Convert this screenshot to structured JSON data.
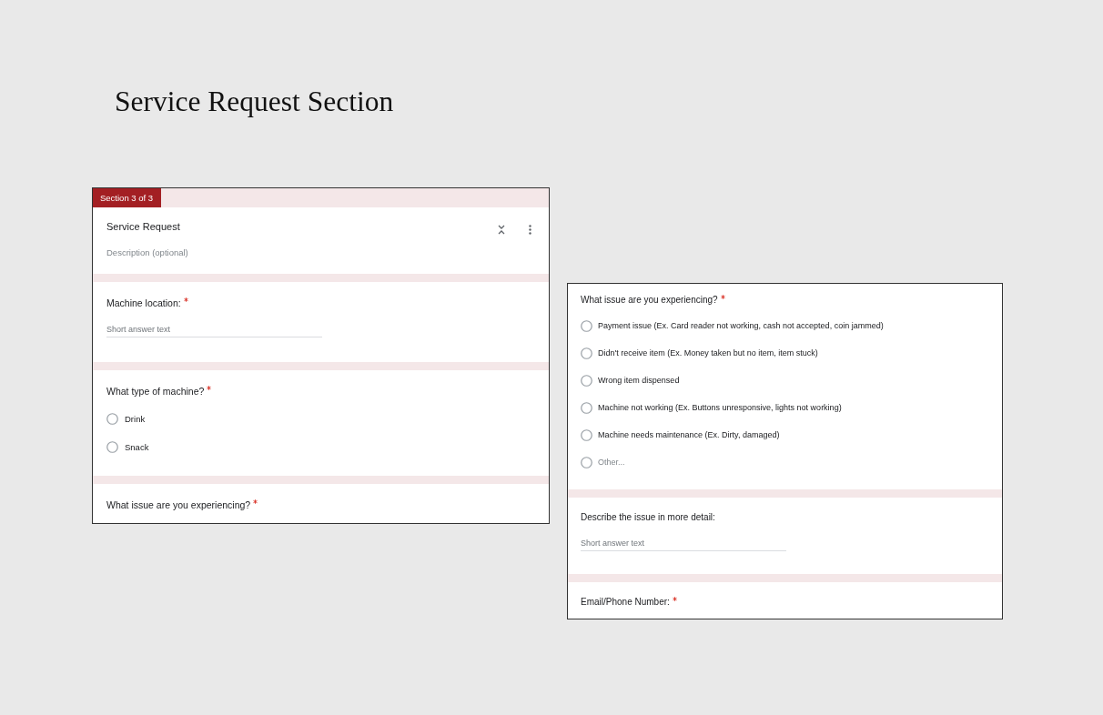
{
  "page_title": "Service Request Section",
  "panels": [
    {
      "section_badge": "Section 3 of 3",
      "section_header": {
        "title": "Service Request",
        "description": {
          "placeholder": "Description (optional)"
        }
      },
      "questions": [
        {
          "kind": "short_answer",
          "title": "Machine location:",
          "required": true,
          "answer": {
            "placeholder": "Short answer text"
          }
        },
        {
          "kind": "multiple_choice",
          "title": "What type of machine?",
          "required": true,
          "options": [
            {
              "kind": "option",
              "label": "Drink",
              "selected": false
            },
            {
              "kind": "option",
              "label": "Snack",
              "selected": false
            }
          ]
        },
        {
          "kind": "partial",
          "title": "What issue are you experiencing?",
          "required": true
        }
      ]
    },
    {
      "questions": [
        {
          "kind": "multiple_choice",
          "title": "What issue are you experiencing?",
          "required": true,
          "options": [
            {
              "kind": "option",
              "label": "Payment issue (Ex. Card reader not working, cash not accepted, coin jammed)",
              "selected": false
            },
            {
              "kind": "option",
              "label": "Didn't receive item (Ex. Money taken but no item, item stuck)",
              "selected": false
            },
            {
              "kind": "option",
              "label": "Wrong item dispensed",
              "selected": false
            },
            {
              "kind": "option",
              "label": "Machine not working (Ex. Buttons unresponsive, lights not working)",
              "selected": false
            },
            {
              "kind": "option",
              "label": "Machine needs maintenance (Ex. Dirty, damaged)",
              "selected": false
            },
            {
              "kind": "other",
              "label": "Other...",
              "selected": false
            }
          ]
        },
        {
          "kind": "short_answer",
          "title": "Describe the issue in more detail:",
          "required": false,
          "answer": {
            "placeholder": "Short answer text"
          }
        },
        {
          "kind": "partial",
          "title": "Email/Phone Number:",
          "required": true
        }
      ]
    }
  ]
}
